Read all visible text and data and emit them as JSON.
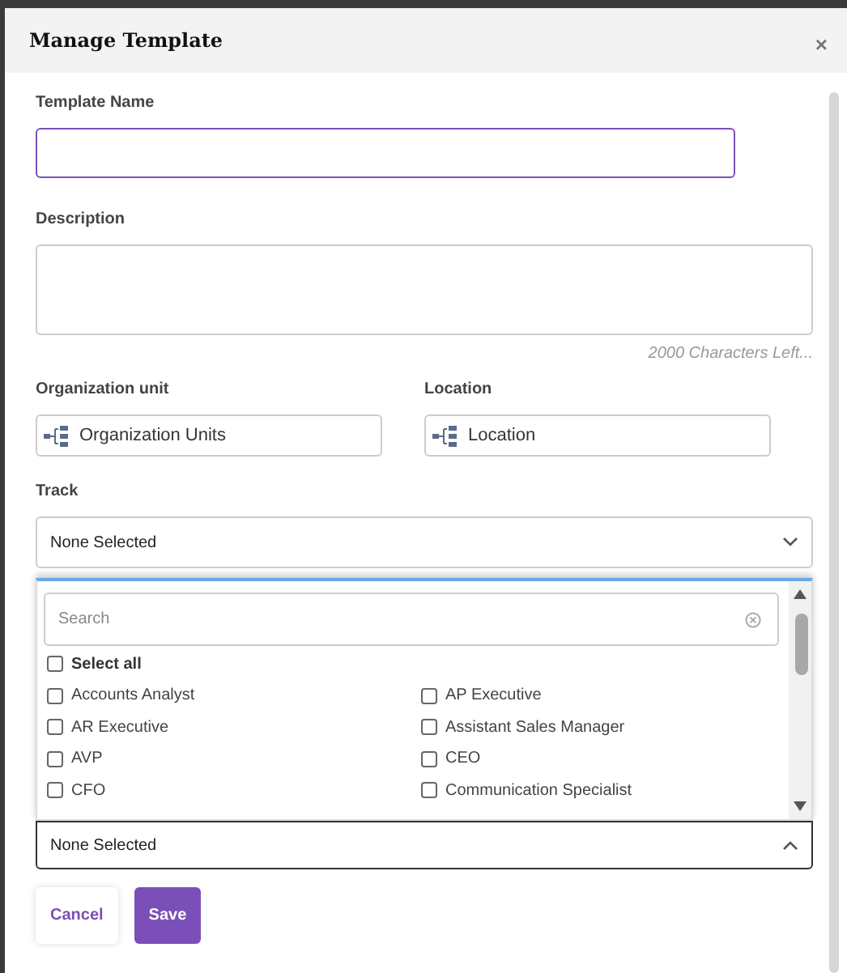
{
  "dialog": {
    "title": "Manage Template",
    "close": "×"
  },
  "template_name": {
    "label": "Template Name",
    "focused": true
  },
  "description": {
    "label": "Description",
    "counter": "2000 Characters Left..."
  },
  "organization_unit": {
    "label": "Organization unit",
    "value": "Organization Units"
  },
  "location": {
    "label": "Location",
    "value": "Location"
  },
  "track": {
    "label": "Track",
    "value": "None Selected",
    "expanded": false
  },
  "track_dropdown": {
    "search_placeholder": "Search",
    "select_all": {
      "label": "Select all",
      "checked": false
    },
    "options": [
      {
        "label": "Accounts Analyst",
        "checked": false
      },
      {
        "label": "AP Executive",
        "checked": false
      },
      {
        "label": "AR Executive",
        "checked": false
      },
      {
        "label": "Assistant Sales Manager",
        "checked": false
      },
      {
        "label": "AVP",
        "checked": false
      },
      {
        "label": "CEO",
        "checked": false
      },
      {
        "label": "CFO",
        "checked": false
      },
      {
        "label": "Communication Specialist",
        "checked": false
      }
    ],
    "value": "None Selected",
    "expanded": true
  },
  "buttons": [
    {
      "label": "Cancel",
      "kind": "secondary"
    },
    {
      "label": "Save",
      "kind": "primary"
    }
  ]
}
